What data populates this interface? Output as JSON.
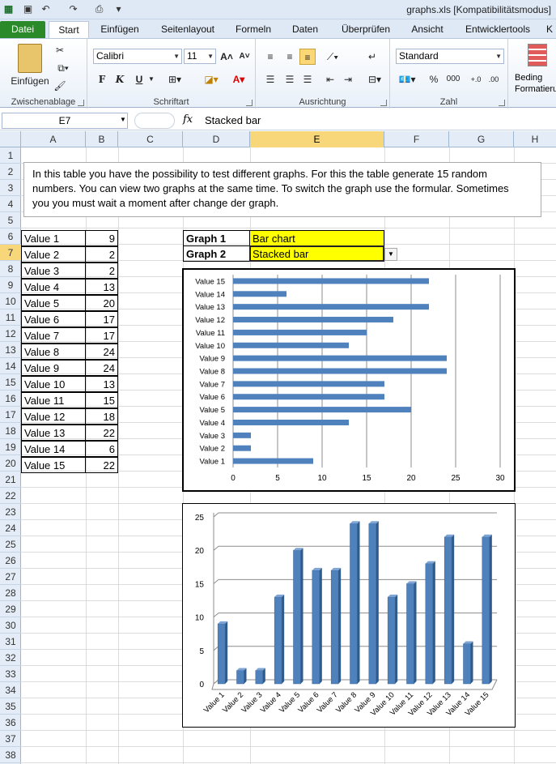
{
  "window": {
    "title": "graphs.xls  [Kompatibilitätsmodus]"
  },
  "ribbon_tabs": [
    "Datei",
    "Start",
    "Einfügen",
    "Seitenlayout",
    "Formeln",
    "Daten",
    "Überprüfen",
    "Ansicht",
    "Entwicklertools",
    "K"
  ],
  "ribbon": {
    "clipboard": {
      "paste": "Einfügen",
      "label": "Zwischenablage"
    },
    "font": {
      "name": "Calibri",
      "size": "11",
      "bold": "F",
      "italic": "K",
      "underline": "U",
      "label": "Schriftart"
    },
    "alignment": {
      "label": "Ausrichtung"
    },
    "number": {
      "format": "Standard",
      "percent": "%",
      "thousands": "000",
      "label": "Zahl"
    },
    "styles": {
      "cond_label": "Beding",
      "cond_label2": "Formatieru"
    }
  },
  "formula_bar": {
    "name_box": "E7",
    "fx": "fx",
    "formula": "Stacked bar"
  },
  "columns": [
    "A",
    "B",
    "C",
    "D",
    "E",
    "F",
    "G",
    "H"
  ],
  "rows": [
    "1",
    "2",
    "3",
    "4",
    "5",
    "6",
    "7",
    "8",
    "9",
    "10",
    "11",
    "12",
    "13",
    "14",
    "15",
    "16",
    "17",
    "18",
    "19",
    "20",
    "21",
    "22",
    "23",
    "24",
    "25",
    "26",
    "27",
    "28",
    "29",
    "30",
    "31",
    "32",
    "33",
    "34",
    "35",
    "36",
    "37",
    "38"
  ],
  "note_lines": [
    "In this table you have the possibility to test different graphs. For this the table generate 15 random",
    "numbers. You can view two graphs at the same time. To switch the graph use the formular. Sometimes",
    "you you must wait a  moment after change der graph."
  ],
  "table": [
    {
      "label": "Value 1",
      "value": 9
    },
    {
      "label": "Value 2",
      "value": 2
    },
    {
      "label": "Value 3",
      "value": 2
    },
    {
      "label": "Value 4",
      "value": 13
    },
    {
      "label": "Value 5",
      "value": 20
    },
    {
      "label": "Value 6",
      "value": 17
    },
    {
      "label": "Value 7",
      "value": 17
    },
    {
      "label": "Value 8",
      "value": 24
    },
    {
      "label": "Value 9",
      "value": 24
    },
    {
      "label": "Value 10",
      "value": 13
    },
    {
      "label": "Value 11",
      "value": 15
    },
    {
      "label": "Value 12",
      "value": 18
    },
    {
      "label": "Value 13",
      "value": 22
    },
    {
      "label": "Value 14",
      "value": 6
    },
    {
      "label": "Value 15",
      "value": 22
    }
  ],
  "graph_selectors": [
    {
      "label": "Graph 1",
      "value": "Bar chart"
    },
    {
      "label": "Graph 2",
      "value": "Stacked bar"
    }
  ],
  "colors": {
    "bar": "#4f81bd",
    "selected_header": "#f8d77a",
    "highlight": "#ffff00"
  },
  "chart_data": [
    {
      "type": "bar",
      "orientation": "horizontal",
      "categories": [
        "Value 1",
        "Value 2",
        "Value 3",
        "Value 4",
        "Value 5",
        "Value 6",
        "Value 7",
        "Value 8",
        "Value 9",
        "Value 10",
        "Value 11",
        "Value 12",
        "Value 13",
        "Value 14",
        "Value 15"
      ],
      "values": [
        9,
        2,
        2,
        13,
        20,
        17,
        17,
        24,
        24,
        13,
        15,
        18,
        22,
        6,
        22
      ],
      "xlim": [
        0,
        30
      ],
      "ticks": [
        0,
        5,
        10,
        15,
        20,
        25,
        30
      ],
      "grid": true,
      "legend": "none"
    },
    {
      "type": "bar",
      "orientation": "vertical",
      "style": "3d",
      "categories": [
        "Value 1",
        "Value 2",
        "Value 3",
        "Value 4",
        "Value 5",
        "Value 6",
        "Value 7",
        "Value 8",
        "Value 9",
        "Value 10",
        "Value 11",
        "Value 12",
        "Value 13",
        "Value 14",
        "Value 15"
      ],
      "values": [
        9,
        2,
        2,
        13,
        20,
        17,
        17,
        24,
        24,
        13,
        15,
        18,
        22,
        6,
        22
      ],
      "ylim": [
        0,
        25
      ],
      "ticks": [
        0,
        5,
        10,
        15,
        20,
        25
      ],
      "grid": true,
      "legend": "none"
    }
  ]
}
